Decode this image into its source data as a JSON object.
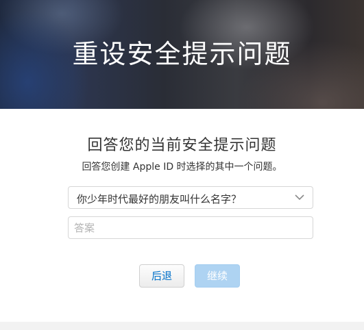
{
  "hero": {
    "title": "重设安全提示问题"
  },
  "main": {
    "subtitle": "回答您的当前安全提示问题",
    "description": "回答您创建 Apple ID 时选择的其中一个问题。",
    "question_select": {
      "selected_value": "你少年时代最好的朋友叫什么名字？",
      "icon": "chevron-down-icon"
    },
    "answer_input": {
      "value": "",
      "placeholder": "答案"
    }
  },
  "buttons": {
    "back_label": "后退",
    "continue_label": "继续"
  },
  "colors": {
    "link_blue": "#0070c9",
    "disabled_primary": "#aed3f2"
  }
}
